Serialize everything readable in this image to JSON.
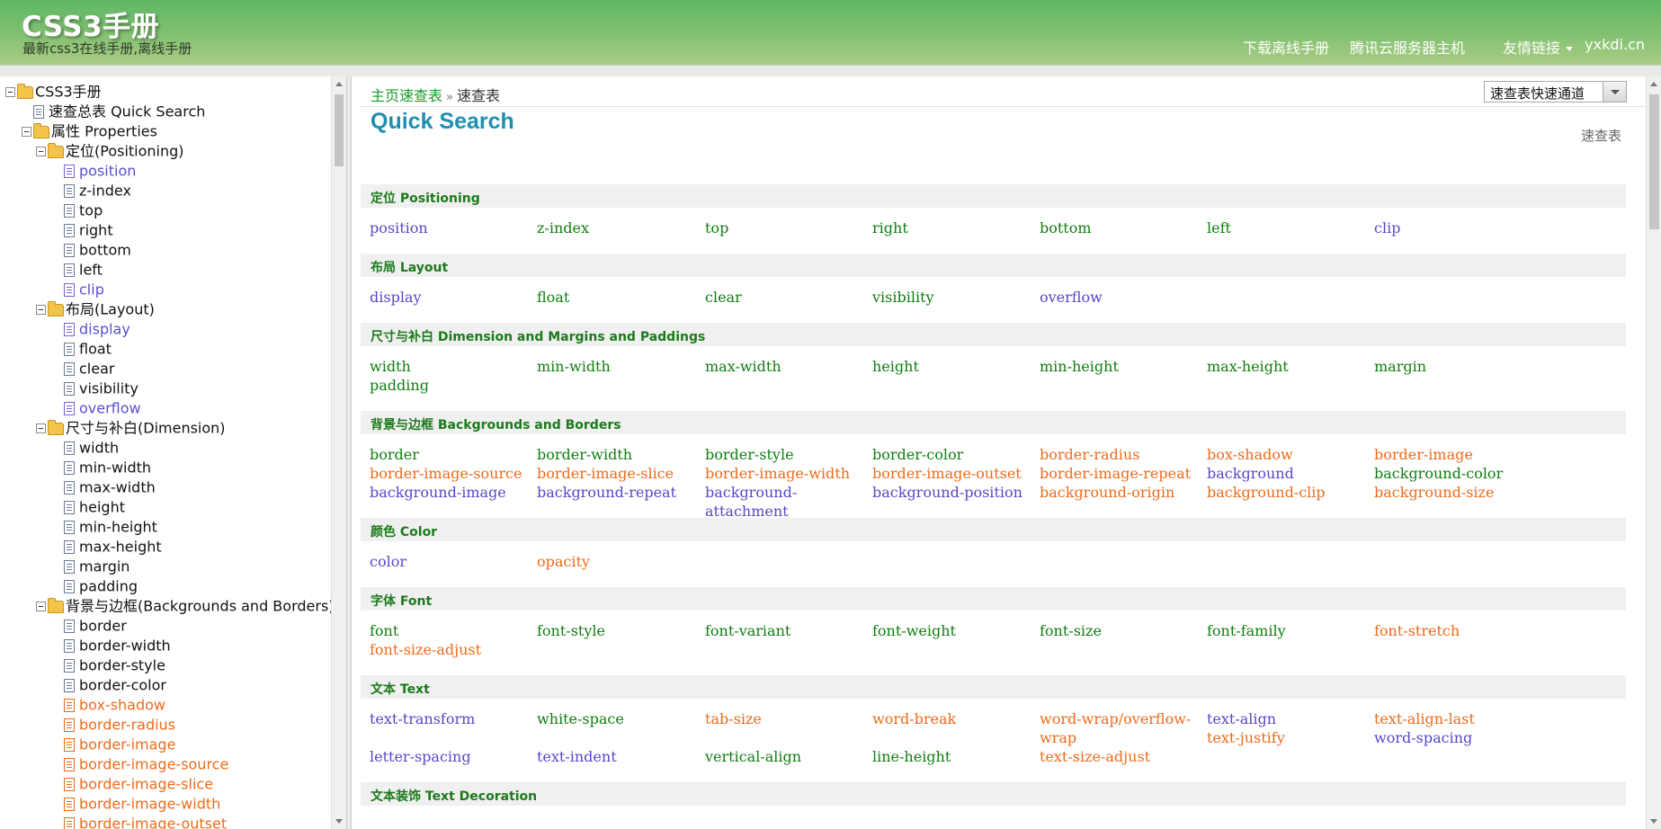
{
  "header": {
    "title": "CSS3手册",
    "subtitle": "最新css3在线手册,离线手册",
    "nav": [
      {
        "label": "下载离线手册"
      },
      {
        "label": "腾讯云服务器主机"
      },
      {
        "label": "友情链接"
      },
      {
        "label": "yxkdi.cn"
      }
    ]
  },
  "sidebar": {
    "tree": [
      {
        "label": "CSS3手册",
        "type": "folder",
        "level": 0
      },
      {
        "label": "速查总表 Quick Search",
        "type": "doc",
        "level": 1
      },
      {
        "label": "属性 Properties",
        "type": "folder",
        "level": 1
      },
      {
        "label": "定位(Positioning)",
        "type": "folder",
        "level": 2
      },
      {
        "label": "position",
        "type": "doc",
        "level": 3,
        "color": "blue"
      },
      {
        "label": "z-index",
        "type": "doc",
        "level": 3
      },
      {
        "label": "top",
        "type": "doc",
        "level": 3
      },
      {
        "label": "right",
        "type": "doc",
        "level": 3
      },
      {
        "label": "bottom",
        "type": "doc",
        "level": 3
      },
      {
        "label": "left",
        "type": "doc",
        "level": 3
      },
      {
        "label": "clip",
        "type": "doc",
        "level": 3,
        "color": "blue"
      },
      {
        "label": "布局(Layout)",
        "type": "folder",
        "level": 2
      },
      {
        "label": "display",
        "type": "doc",
        "level": 3,
        "color": "blue"
      },
      {
        "label": "float",
        "type": "doc",
        "level": 3
      },
      {
        "label": "clear",
        "type": "doc",
        "level": 3
      },
      {
        "label": "visibility",
        "type": "doc",
        "level": 3
      },
      {
        "label": "overflow",
        "type": "doc",
        "level": 3,
        "color": "blue"
      },
      {
        "label": "尺寸与补白(Dimension)",
        "type": "folder",
        "level": 2
      },
      {
        "label": "width",
        "type": "doc",
        "level": 3
      },
      {
        "label": "min-width",
        "type": "doc",
        "level": 3
      },
      {
        "label": "max-width",
        "type": "doc",
        "level": 3
      },
      {
        "label": "height",
        "type": "doc",
        "level": 3
      },
      {
        "label": "min-height",
        "type": "doc",
        "level": 3
      },
      {
        "label": "max-height",
        "type": "doc",
        "level": 3
      },
      {
        "label": "margin",
        "type": "doc",
        "level": 3
      },
      {
        "label": "padding",
        "type": "doc",
        "level": 3
      },
      {
        "label": "背景与边框(Backgrounds and Borders)",
        "type": "folder",
        "level": 2
      },
      {
        "label": "border",
        "type": "doc",
        "level": 3
      },
      {
        "label": "border-width",
        "type": "doc",
        "level": 3
      },
      {
        "label": "border-style",
        "type": "doc",
        "level": 3
      },
      {
        "label": "border-color",
        "type": "doc",
        "level": 3
      },
      {
        "label": "box-shadow",
        "type": "doc",
        "level": 3,
        "color": "orange"
      },
      {
        "label": "border-radius",
        "type": "doc",
        "level": 3,
        "color": "orange"
      },
      {
        "label": "border-image",
        "type": "doc",
        "level": 3,
        "color": "orange"
      },
      {
        "label": "border-image-source",
        "type": "doc",
        "level": 3,
        "color": "orange"
      },
      {
        "label": "border-image-slice",
        "type": "doc",
        "level": 3,
        "color": "orange"
      },
      {
        "label": "border-image-width",
        "type": "doc",
        "level": 3,
        "color": "orange"
      },
      {
        "label": "border-image-outset",
        "type": "doc",
        "level": 3,
        "color": "orange"
      }
    ]
  },
  "main": {
    "breadcrumb": {
      "home": "主页速查表",
      "current": "速查表"
    },
    "quick_select": "速查表快速通道",
    "title": "Quick Search",
    "tag": "速查表",
    "sections": [
      {
        "title": "定位 Positioning",
        "rows": [
          [
            {
              "t": "position",
              "c": "blue"
            },
            {
              "t": "z-index",
              "c": "green"
            },
            {
              "t": "top",
              "c": "green"
            },
            {
              "t": "right",
              "c": "green"
            },
            {
              "t": "bottom",
              "c": "green"
            },
            {
              "t": "left",
              "c": "green"
            },
            {
              "t": "clip",
              "c": "blue"
            }
          ]
        ]
      },
      {
        "title": "布局 Layout",
        "rows": [
          [
            {
              "t": "display",
              "c": "blue"
            },
            {
              "t": "float",
              "c": "green"
            },
            {
              "t": "clear",
              "c": "green"
            },
            {
              "t": "visibility",
              "c": "green"
            },
            {
              "t": "overflow",
              "c": "blue"
            }
          ]
        ]
      },
      {
        "title": "尺寸与补白 Dimension and Margins and Paddings",
        "rows": [
          [
            {
              "t": "width",
              "c": "green"
            },
            {
              "t": "min-width",
              "c": "green"
            },
            {
              "t": "max-width",
              "c": "green"
            },
            {
              "t": "height",
              "c": "green"
            },
            {
              "t": "min-height",
              "c": "green"
            },
            {
              "t": "max-height",
              "c": "green"
            },
            {
              "t": "margin",
              "c": "green"
            }
          ],
          [
            {
              "t": "padding",
              "c": "green"
            }
          ]
        ]
      },
      {
        "title": "背景与边框 Backgrounds and Borders",
        "rows": [
          [
            {
              "t": "border",
              "c": "green"
            },
            {
              "t": "border-width",
              "c": "green"
            },
            {
              "t": "border-style",
              "c": "green"
            },
            {
              "t": "border-color",
              "c": "green"
            },
            {
              "t": "border-radius",
              "c": "orange"
            },
            {
              "t": "box-shadow",
              "c": "orange"
            },
            {
              "t": "border-image",
              "c": "orange"
            }
          ],
          [
            {
              "t": "border-image-source",
              "c": "orange"
            },
            {
              "t": "border-image-slice",
              "c": "orange"
            },
            {
              "t": "border-image-width",
              "c": "orange"
            },
            {
              "t": "border-image-outset",
              "c": "orange"
            },
            {
              "t": "border-image-repeat",
              "c": "orange"
            },
            {
              "t": "background",
              "c": "blue"
            },
            {
              "t": "background-color",
              "c": "green"
            }
          ],
          [
            {
              "t": "background-image",
              "c": "blue"
            },
            {
              "t": "background-repeat",
              "c": "blue"
            },
            {
              "t": "background-attachment",
              "c": "blue"
            },
            {
              "t": "background-position",
              "c": "blue"
            },
            {
              "t": "background-origin",
              "c": "orange"
            },
            {
              "t": "background-clip",
              "c": "orange"
            },
            {
              "t": "background-size",
              "c": "orange"
            }
          ]
        ]
      },
      {
        "title": "颜色 Color",
        "rows": [
          [
            {
              "t": "color",
              "c": "blue"
            },
            {
              "t": "opacity",
              "c": "orange"
            }
          ]
        ]
      },
      {
        "title": "字体 Font",
        "rows": [
          [
            {
              "t": "font",
              "c": "green"
            },
            {
              "t": "font-style",
              "c": "green"
            },
            {
              "t": "font-variant",
              "c": "green"
            },
            {
              "t": "font-weight",
              "c": "green"
            },
            {
              "t": "font-size",
              "c": "green"
            },
            {
              "t": "font-family",
              "c": "green"
            },
            {
              "t": "font-stretch",
              "c": "orange"
            }
          ],
          [
            {
              "t": "font-size-adjust",
              "c": "orange"
            }
          ]
        ]
      },
      {
        "title": "文本 Text",
        "rows": [
          [
            {
              "t": "text-transform",
              "c": "blue"
            },
            {
              "t": "white-space",
              "c": "green"
            },
            {
              "t": "tab-size",
              "c": "orange"
            },
            {
              "t": "word-break",
              "c": "orange"
            },
            {
              "t": "word-wrap/overflow-wrap",
              "c": "orange"
            },
            {
              "t": "text-align",
              "c": "blue"
            },
            {
              "t": "text-align-last",
              "c": "orange"
            }
          ],
          [
            {
              "t": "",
              "c": "green"
            },
            {
              "t": "",
              "c": "green"
            },
            {
              "t": "",
              "c": "green"
            },
            {
              "t": "",
              "c": "green"
            },
            {
              "t": "",
              "c": "green"
            },
            {
              "t": "text-justify",
              "c": "orange"
            },
            {
              "t": "word-spacing",
              "c": "blue"
            }
          ],
          [
            {
              "t": "letter-spacing",
              "c": "blue"
            },
            {
              "t": "text-indent",
              "c": "blue"
            },
            {
              "t": "vertical-align",
              "c": "green"
            },
            {
              "t": "line-height",
              "c": "green"
            },
            {
              "t": "text-size-adjust",
              "c": "orange"
            }
          ]
        ]
      },
      {
        "title": "文本装饰 Text Decoration",
        "rows": []
      }
    ]
  },
  "colors": {
    "green": "#107d10",
    "blue": "#5547c9",
    "orange": "#ee6a1a",
    "title": "#1f8fb0"
  }
}
